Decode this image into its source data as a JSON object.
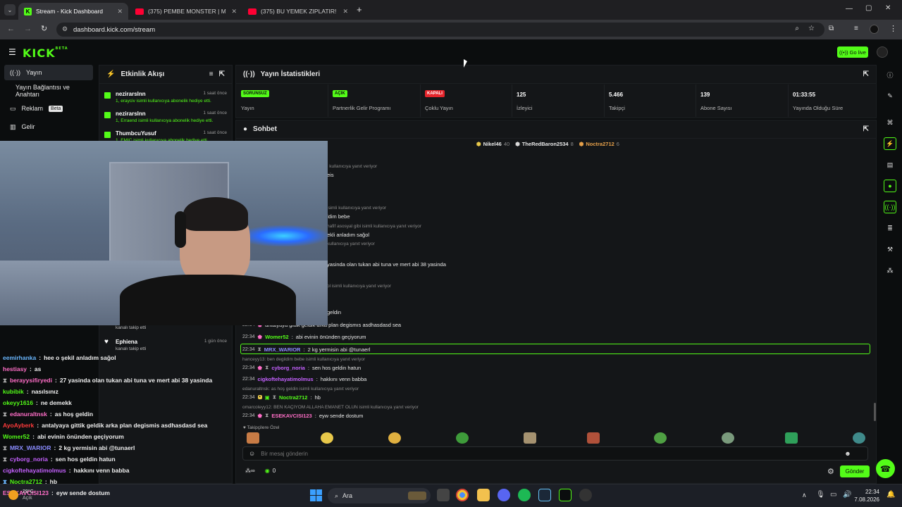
{
  "browser": {
    "tabs": [
      {
        "label": "Stream - Kick Dashboard",
        "active": true
      },
      {
        "label": "(375) PEMBE MONSTER | Mada",
        "active": false
      },
      {
        "label": "(375) BU YEMEK ZIPLATIR! ELRA",
        "active": false
      }
    ],
    "url": "dashboard.kick.com/stream"
  },
  "header": {
    "logo": "KICK",
    "logo_sup": "BETA",
    "go_live": "Go live"
  },
  "sidebar": {
    "items": [
      {
        "label": "Yayın",
        "icon": "broadcast-icon",
        "active": true
      },
      {
        "label": "Yayın Bağlantısı ve Anahtarı",
        "icon": "",
        "active": false
      },
      {
        "label": "Reklam",
        "icon": "ad-icon",
        "badge": "Beta",
        "active": false
      },
      {
        "label": "Gelir",
        "icon": "chart-icon",
        "active": false
      }
    ]
  },
  "activity": {
    "title": "Etkinlik Akışı",
    "items": [
      {
        "name": "nezirarslnn",
        "detail": "1, erayciv isimli kullanıcıya abonelik hediye etti.",
        "time": "1 saat önce"
      },
      {
        "name": "nezirarslnn",
        "detail": "1, Erraend isimli kullanıcıya abonelik hediye etti.",
        "time": "1 saat önce"
      },
      {
        "name": "ThumbcuYusuf",
        "detail": "1, EMIC isimli kullanıcıya abonelik hediye etti.",
        "time": "1 saat önce"
      },
      {
        "name": "",
        "detail": "kanalı takip etti",
        "time": ""
      },
      {
        "name": "Ephiena",
        "detail": "kanalı takip etti",
        "time": "1 gün önce"
      }
    ]
  },
  "stats": {
    "title": "Yayın İstatistikleri",
    "items": [
      {
        "pill": "SORUNSUZ",
        "label": "Yayın",
        "pill_color": "#53fc18",
        "pill_text": "#0b0d0e"
      },
      {
        "pill": "AÇIK",
        "label": "Partnerlik Gelir Programı",
        "pill_color": "#53fc18",
        "pill_text": "#0b0d0e"
      },
      {
        "pill": "KAPALI",
        "label": "Çoklu Yayın",
        "pill_color": "#e5242b",
        "pill_text": "#ffffff"
      },
      {
        "value": "125",
        "label": "İzleyici"
      },
      {
        "value": "5.466",
        "label": "Takipçi"
      },
      {
        "value": "139",
        "label": "Abone Sayısı"
      },
      {
        "value": "01:33:55",
        "label": "Yayında Olduğu Süre"
      }
    ]
  },
  "chat": {
    "title": "Sohbet",
    "top_gifters": [
      {
        "name": "Nikel46",
        "count": "40",
        "color": "#e8c84a"
      },
      {
        "name": "TheRedBaron2534",
        "count": "8",
        "color": "#d9d9d9"
      },
      {
        "name": "Noctra2712",
        "count": "6",
        "color": "#e5a04a"
      }
    ],
    "partial_lines": [
      {
        "text": "i kullanıcıya yanıt veriyor",
        "reply": true
      },
      {
        "text": "eis",
        "reply": false
      },
      {
        "text": "isimli kullanıcıya yanıt veriyor",
        "reply": true
      },
      {
        "text": "ldim bebe",
        "reply": false
      },
      {
        "text": "hafif asosyal gibi isimli kullanıcıya yanıt veriyor",
        "reply": true
      },
      {
        "text": "ekli anladım sağol",
        "reply": false
      },
      {
        "text": "kullanıcıya yanıt veriyor",
        "reply": true
      },
      {
        "text": "yasinda olan tukan abi tuna ve mert abi 38 yasinda",
        "reply": false
      },
      {
        "text": "ol isimli kullanıcıya yanıt veriyor",
        "reply": true
      },
      {
        "text": "geldin",
        "reply": false
      }
    ],
    "messages": [
      {
        "time": "22:34",
        "user": "",
        "color": "#ff6ec7",
        "text": "antalyaya gittik geldik arka plan degismıs asdhasdasd sea"
      },
      {
        "time": "22:34",
        "user": "Womer52",
        "color": "#53fc18",
        "text": "abi evinin önünden geçiyorum"
      },
      {
        "time": "22:34",
        "user": "MRX_WARIOR",
        "color": "#8a8cff",
        "text": "2 kg yermisin abi @tunaerl",
        "highlight": true
      },
      {
        "time": "",
        "user": "",
        "color": "",
        "text": "hanceyy13: ben degildim bebe isimli kullanıcıya yanıt veriyor",
        "reply": true
      },
      {
        "time": "22:34",
        "user": "cyborg_noria",
        "color": "#c561ff",
        "text": "sen hos geldin hatun"
      },
      {
        "time": "22:34",
        "user": "cigkoftehayatimolmus",
        "color": "#c561ff",
        "text": "hakkını venn babba"
      },
      {
        "time": "",
        "user": "",
        "color": "",
        "text": "edanuraltnsk: as hoş geldin isimli kullanıcıya yanıt veriyor",
        "reply": true
      },
      {
        "time": "22:34",
        "user": "Noctra2712",
        "color": "#53fc18",
        "text": "hb"
      },
      {
        "time": "",
        "user": "",
        "color": "",
        "text": "omarcoleyy12: BEN KAÇIYOM ALLAHA EMANET OLUN isimli kullanıcıya yanıt veriyor",
        "reply": true
      },
      {
        "time": "22:34",
        "user": "ESEKAVCISI123",
        "color": "#ff6ec7",
        "text": "eyw sende dostum"
      }
    ],
    "emote_section": "Takipçilere Özel",
    "input_placeholder": "Bir mesaj gönderin",
    "send": "Gönder",
    "points": "0"
  },
  "overlay_chat": [
    {
      "user": "eemirhanka",
      "color": "#6ab7ff",
      "text": "hee o şekil anladım sağol"
    },
    {
      "user": "hestiasy",
      "color": "#ff6ec7",
      "text": "as"
    },
    {
      "user": "berayysifiryedi",
      "color": "#ff6ec7",
      "text": "27 yasinda olan tukan abi tuna ve mert abi 38 yasinda"
    },
    {
      "user": "kubibik",
      "color": "#53fc18",
      "text": "nasılsınız"
    },
    {
      "user": "okeyy1616",
      "color": "#53fc18",
      "text": "ne demekk"
    },
    {
      "user": "edanuraltnsk",
      "color": "#ff6ec7",
      "text": "as hoş geldin"
    },
    {
      "user": "AyoAyberk",
      "color": "#ff3b3b",
      "text": "antalyaya gittik geldik arka plan degismis asdhasdasd sea"
    },
    {
      "user": "Womer52",
      "color": "#53fc18",
      "text": "abi evinin önünden geçiyorum"
    },
    {
      "user": "MRX_WARIOR",
      "color": "#8a8cff",
      "text": "2 kg yermisin abi @tunaerl"
    },
    {
      "user": "cyborg_noria",
      "color": "#c561ff",
      "text": "sen hos geldin hatun"
    },
    {
      "user": "cigkoftehayatimolmus",
      "color": "#c561ff",
      "text": "hakkını venn babba"
    },
    {
      "user": "Noctra2712",
      "color": "#53fc18",
      "text": "hb"
    },
    {
      "user": "ESEKAVCISI123",
      "color": "#ff6ec7",
      "text": "eyw sende dostum"
    }
  ],
  "taskbar": {
    "weather_temp": "29°C",
    "weather_label": "Açık",
    "search": "Ara",
    "time": "22:34",
    "date": "7.08.2026"
  },
  "colors": {
    "accent": "#53fc18",
    "bg": "#0b0d0e",
    "panel": "#141618"
  }
}
